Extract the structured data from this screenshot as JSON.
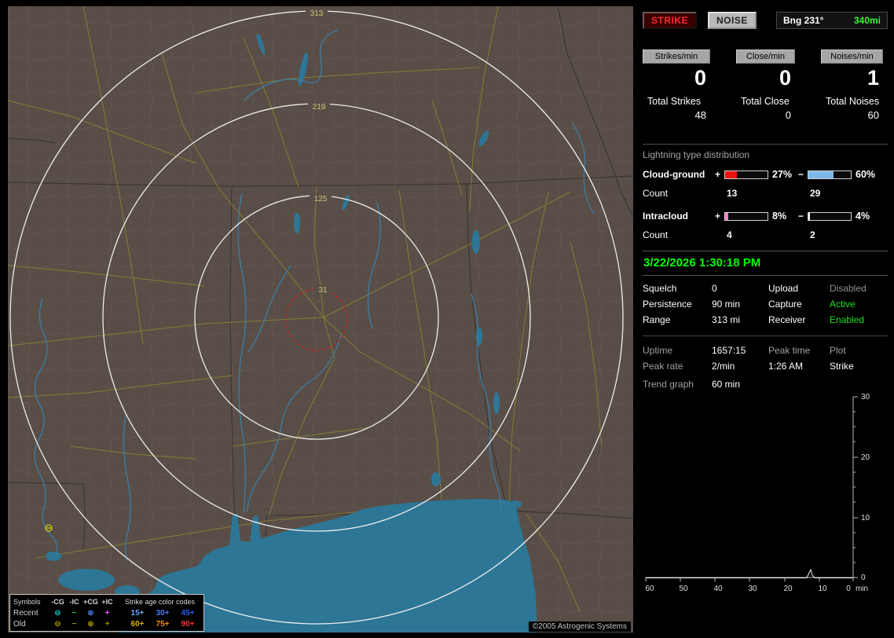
{
  "accent": {
    "green": "#00ff00",
    "bright_green": "#2aff2a",
    "red": "#ff2a2a"
  },
  "map": {
    "range_labels": [
      "313",
      "219",
      "125",
      "31"
    ],
    "copyright": "©2005 Astrogenic Systems",
    "legend": {
      "header_symbols": "Symbols",
      "type_headers": [
        "-CG",
        "-IC",
        "+CG",
        "+IC"
      ],
      "age_header": "Strike age color codes",
      "rows": [
        {
          "label": "Recent",
          "symbols": [
            {
              "char": "⊖",
              "color": "#00e0e0"
            },
            {
              "char": "−",
              "color": "#22cc44"
            },
            {
              "char": "⊕",
              "color": "#4f8cff"
            },
            {
              "char": "+",
              "color": "#ff55ff"
            }
          ],
          "ages": [
            {
              "label": "15+",
              "color": "#6ea6ff"
            },
            {
              "label": "30+",
              "color": "#4b7dff"
            },
            {
              "label": "45+",
              "color": "#2d5cf2"
            }
          ]
        },
        {
          "label": "Old",
          "symbols": [
            {
              "char": "⊖",
              "color": "#b8a800"
            },
            {
              "char": "−",
              "color": "#9a9000"
            },
            {
              "char": "⊕",
              "color": "#b8a800"
            },
            {
              "char": "+",
              "color": "#9a9000"
            }
          ],
          "ages": [
            {
              "label": "60+",
              "color": "#d8b400"
            },
            {
              "label": "75+",
              "color": "#ff8a00"
            },
            {
              "label": "90+",
              "color": "#ff3030"
            }
          ]
        }
      ]
    }
  },
  "panel": {
    "tabs": {
      "strike": "STRIKE",
      "noise": "NOISE"
    },
    "bearing": {
      "label": "Bng 231°",
      "range": "340mi"
    },
    "rates": [
      {
        "header": "Strikes/min",
        "rate": "0",
        "total_label": "Total Strikes",
        "total": "48"
      },
      {
        "header": "Close/min",
        "rate": "0",
        "total_label": "Total Close",
        "total": "0"
      },
      {
        "header": "Noises/min",
        "rate": "1",
        "total_label": "Total Noises",
        "total": "60"
      }
    ],
    "distribution": {
      "title": "Lightning type distribution",
      "count_label": "Count",
      "rows": [
        {
          "name": "Cloud-ground",
          "plus_sign": "+",
          "minus_sign": "−",
          "plus_pct": "27%",
          "plus_fill": 27,
          "plus_color": "#ee1111",
          "minus_pct": "60%",
          "minus_fill": 60,
          "minus_color": "#7db8ea",
          "plus_count": "13",
          "minus_count": "29"
        },
        {
          "name": "Intracloud",
          "plus_sign": "+",
          "minus_sign": "−",
          "plus_pct": "8%",
          "plus_fill": 8,
          "plus_color": "#ff7dd2",
          "minus_pct": "4%",
          "minus_fill": 4,
          "minus_color": "#f0f0f0",
          "plus_count": "4",
          "minus_count": "2"
        }
      ]
    },
    "datetime": "3/22/2026 1:30:18 PM",
    "settings": [
      {
        "label": "Squelch",
        "value": "0",
        "label2": "Upload",
        "value2": "Disabled",
        "value2_color": "#8f8f8f"
      },
      {
        "label": "Persistence",
        "value": "90 min",
        "label2": "Capture",
        "value2": "Active",
        "value2_color": "#18e018"
      },
      {
        "label": "Range",
        "value": "313 mi",
        "label2": "Receiver",
        "value2": "Enabled",
        "value2_color": "#18e018"
      }
    ],
    "stats": {
      "r1": {
        "label": "Uptime",
        "value": "1657:15",
        "label2": "Peak time",
        "label3": "Plot"
      },
      "r2": {
        "label": "Peak rate",
        "value": "2/min",
        "value2": "1:26 AM",
        "value3": "Strike"
      }
    },
    "trend": {
      "label": "Trend graph",
      "window": "60 min",
      "y_ticks": [
        "30",
        "20",
        "10",
        "0"
      ],
      "x_ticks": [
        "60",
        "50",
        "40",
        "30",
        "20",
        "10",
        "0"
      ],
      "x_unit": "min",
      "chart_data": {
        "type": "line",
        "series": [
          {
            "name": "Strike",
            "x_min_ago": [
              60,
              50,
              40,
              30,
              20,
              15,
              13,
              12,
              11,
              10,
              0
            ],
            "values": [
              0,
              0,
              0,
              0,
              0,
              0,
              1,
              3,
              1,
              0,
              0
            ]
          }
        ],
        "xlim": [
          60,
          0
        ],
        "ylim": [
          0,
          30
        ],
        "note": "flat at 0 with one small spike about 12 min ago"
      }
    }
  }
}
